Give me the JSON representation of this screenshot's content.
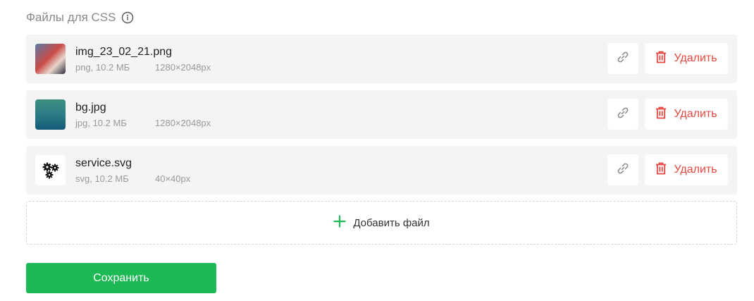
{
  "section": {
    "title": "Файлы для CSS",
    "info_icon": "info-circle-icon"
  },
  "files": [
    {
      "name": "img_23_02_21.png",
      "type_size": "png, 10.2 МБ",
      "dimensions": "1280×2048px",
      "thumbnail": "photo"
    },
    {
      "name": "bg.jpg",
      "type_size": "jpg, 10.2 МБ",
      "dimensions": "1280×2048px",
      "thumbnail": "gradient"
    },
    {
      "name": "service.svg",
      "type_size": "svg, 10.2 МБ",
      "dimensions": "40×40px",
      "thumbnail": "gears-icon"
    }
  ],
  "actions": {
    "delete_label": "Удалить",
    "link_icon": "link-icon",
    "delete_icon": "trash-icon"
  },
  "add_file": {
    "label": "Добавить файл",
    "icon": "plus-icon"
  },
  "save": {
    "label": "Сохранить"
  },
  "colors": {
    "accent": "#1db954",
    "danger": "#e8473f",
    "row_bg": "#f4f4f4",
    "muted_text": "#9a9a9a"
  }
}
